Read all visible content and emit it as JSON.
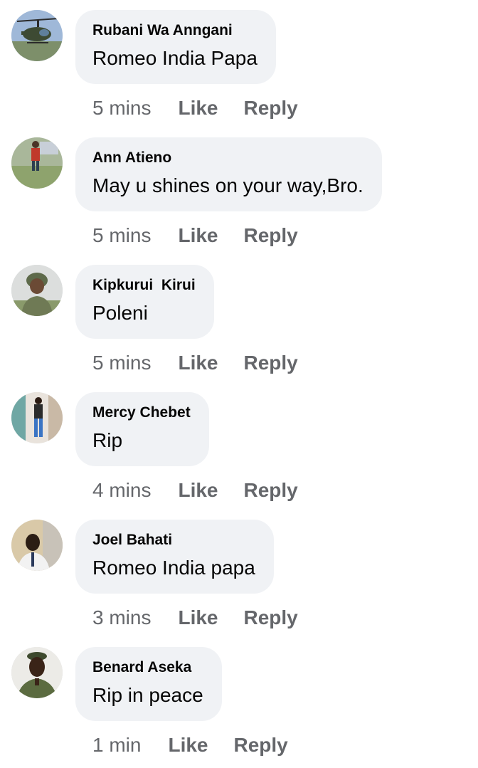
{
  "comments": [
    {
      "author": "Rubani Wa Anngani",
      "text": "Romeo India Papa",
      "time": "5 mins",
      "like_label": "Like",
      "reply_label": "Reply",
      "avatar_icon": "helicopter-avatar"
    },
    {
      "author": "Ann Atieno",
      "text": "May u shines on your way,Bro.",
      "time": "5 mins",
      "like_label": "Like",
      "reply_label": "Reply",
      "avatar_icon": "person-outdoor-avatar"
    },
    {
      "author": "Kipkurui  Kirui",
      "text": "Poleni",
      "time": "5 mins",
      "like_label": "Like",
      "reply_label": "Reply",
      "avatar_icon": "soldier-helmet-avatar"
    },
    {
      "author": "Mercy Chebet",
      "text": "Rip",
      "time": "4 mins",
      "like_label": "Like",
      "reply_label": "Reply",
      "avatar_icon": "woman-standing-avatar"
    },
    {
      "author": "Joel Bahati",
      "text": "Romeo India papa",
      "time": "3 mins",
      "like_label": "Like",
      "reply_label": "Reply",
      "avatar_icon": "man-portrait-avatar"
    },
    {
      "author": "Benard Aseka",
      "text": "Rip in peace",
      "time": "1 min",
      "like_label": "Like",
      "reply_label": "Reply",
      "avatar_icon": "soldier-beret-avatar"
    }
  ],
  "colors": {
    "bubble_bg": "#f0f2f5",
    "text": "#050505",
    "meta": "#65676b"
  }
}
